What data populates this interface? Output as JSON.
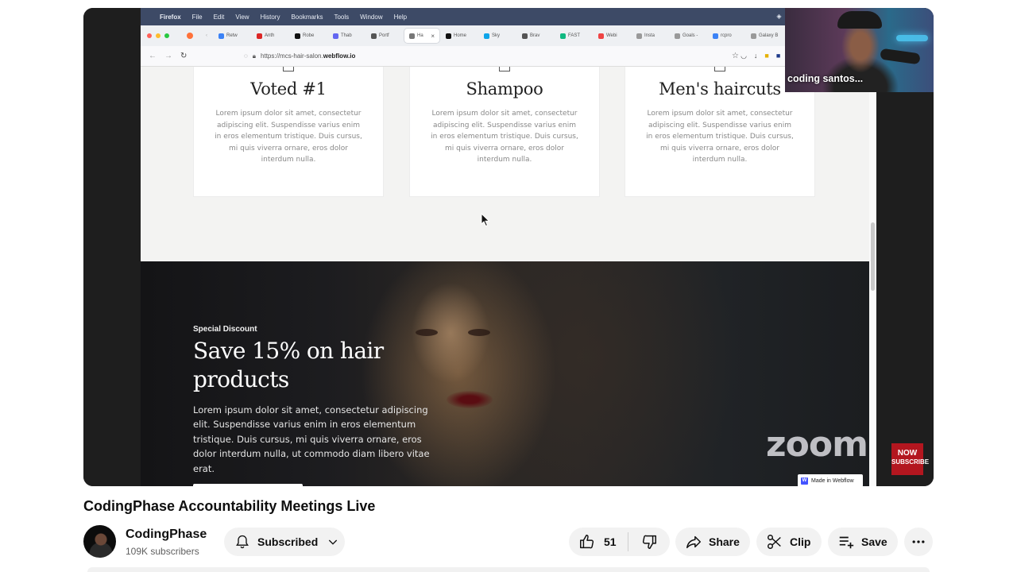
{
  "menubar": {
    "app": "Firefox",
    "items": [
      "File",
      "Edit",
      "View",
      "History",
      "Bookmarks",
      "Tools",
      "Window",
      "Help"
    ]
  },
  "tabs": [
    {
      "label": "Retw",
      "color": "#3b82f6"
    },
    {
      "label": "Anth",
      "color": "#dc2626"
    },
    {
      "label": "Robe",
      "color": "#111111"
    },
    {
      "label": "Thab",
      "color": "#6366f1"
    },
    {
      "label": "Portf",
      "color": "#555555"
    },
    {
      "label": "Ha",
      "color": "#777777",
      "active": true
    },
    {
      "label": "Home",
      "color": "#111111"
    },
    {
      "label": "Sky",
      "color": "#0ea5e9"
    },
    {
      "label": "Brav",
      "color": "#555555"
    },
    {
      "label": "FAST",
      "color": "#10b981"
    },
    {
      "label": "Webi",
      "color": "#ef4444"
    },
    {
      "label": "Insta",
      "color": "#999999"
    },
    {
      "label": "Goals -",
      "color": "#999999"
    },
    {
      "label": "rcpro",
      "color": "#3b82f6"
    },
    {
      "label": "Galaxy B",
      "color": "#999999"
    }
  ],
  "address": {
    "url_prefix": "https://mcs-hair-salon.",
    "url_domain": "webflow.io"
  },
  "cards": [
    {
      "title": "Voted #1",
      "body": "Lorem ipsum dolor sit amet, consectetur adipiscing elit. Suspendisse varius enim in eros elementum tristique. Duis cursus, mi quis viverra ornare, eros dolor interdum nulla."
    },
    {
      "title": "Shampoo",
      "body": "Lorem ipsum dolor sit amet, consectetur adipiscing elit. Suspendisse varius enim in eros elementum tristique. Duis cursus, mi quis viverra ornare, eros dolor interdum nulla."
    },
    {
      "title": "Men's haircuts",
      "body": "Lorem ipsum dolor sit amet, consectetur adipiscing elit. Suspendisse varius enim in eros elementum tristique. Duis cursus, mi quis viverra ornare, eros dolor interdum nulla."
    }
  ],
  "hero": {
    "eyebrow": "Special Discount",
    "title": "Save 15% on hair products",
    "body": "Lorem ipsum dolor sit amet, consectetur adipiscing elit. Suspendisse varius enim in eros elementum tristique. Duis cursus, mi quis viverra ornare, eros dolor interdum nulla, ut commodo diam libero vitae erat."
  },
  "overlays": {
    "zoom_watermark": "zoom",
    "webflow_badge": "Made in Webflow",
    "webcam_name": "coding santos...",
    "subscribe_badge_line1": "NOW",
    "subscribe_badge_line2": "SUBSCRIBE"
  },
  "video": {
    "title": "CodingPhase Accountability Meetings Live",
    "channel": "CodingPhase",
    "subscribers": "109K subscribers",
    "subscribed_label": "Subscribed",
    "likes": "51",
    "share_label": "Share",
    "clip_label": "Clip",
    "save_label": "Save"
  },
  "colors": {
    "brand_red": "#b3161f",
    "webflow_blue": "#4353ff",
    "menubar": "#3d4a66"
  }
}
